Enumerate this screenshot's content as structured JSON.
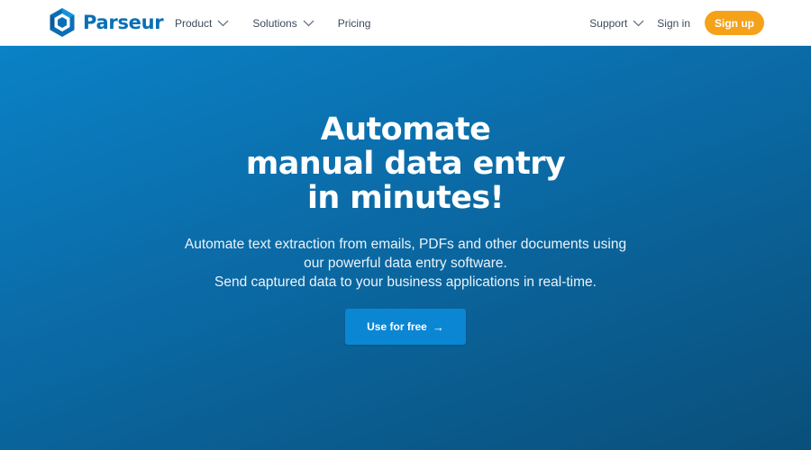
{
  "brand": {
    "name": "Parseur",
    "logo_icon": "parseur-hexagon-logo",
    "color": "#0a6fb5"
  },
  "nav": {
    "left_items": [
      {
        "label": "Product",
        "has_dropdown": true
      },
      {
        "label": "Solutions",
        "has_dropdown": true
      },
      {
        "label": "Pricing",
        "has_dropdown": false
      }
    ],
    "support_label": "Support",
    "signin_label": "Sign in",
    "signup_label": "Sign up",
    "signup_color": "#f5a21a"
  },
  "hero": {
    "headline_lines": [
      "Automate",
      "manual data entry",
      "in minutes!"
    ],
    "subtext_lines": [
      "Automate text extraction from emails, PDFs and other documents using",
      "our powerful data entry software.",
      "Send captured data to your business applications in real-time."
    ],
    "cta_label": "Use for free",
    "cta_icon": "arrow-right-icon",
    "background_colors": [
      "#0a82c6",
      "#0a4f7b"
    ]
  }
}
